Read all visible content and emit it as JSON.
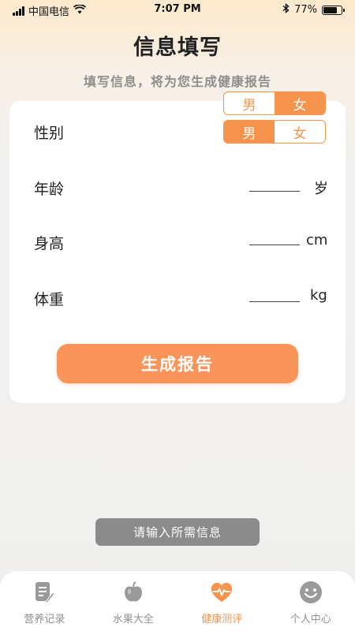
{
  "status_bar": {
    "carrier": "中国电信",
    "time": "7:07 PM",
    "battery": "77%",
    "battery_level": 0.77,
    "icons": [
      "signal-icon",
      "wifi-icon",
      "bluetooth-icon",
      "battery-icon"
    ]
  },
  "header": {
    "title": "信息填写",
    "subtitle": "填写信息，将为您生成健康报告"
  },
  "gender_toggle_top": {
    "options": [
      "男",
      "女"
    ],
    "selected": "女"
  },
  "form": {
    "gender": {
      "label": "性别",
      "options": [
        "男",
        "女"
      ],
      "selected": "男"
    },
    "age": {
      "label": "年龄",
      "value": "",
      "unit": "岁"
    },
    "height": {
      "label": "身高",
      "value": "",
      "unit": "cm"
    },
    "weight": {
      "label": "体重",
      "value": "",
      "unit": "kg"
    },
    "submit_label": "生成报告"
  },
  "toast": {
    "message": "请输入所需信息"
  },
  "tab_bar": {
    "active": "health",
    "tabs": [
      {
        "key": "nutrition",
        "label": "营养记录",
        "icon": "notes-icon"
      },
      {
        "key": "fruits",
        "label": "水果大全",
        "icon": "fruit-icon"
      },
      {
        "key": "health",
        "label": "健康测评",
        "icon": "heart-pulse-icon"
      },
      {
        "key": "profile",
        "label": "个人中心",
        "icon": "smiley-icon"
      }
    ]
  },
  "colors": {
    "accent": "#f6934c",
    "button": "#f9955a",
    "toast_bg": "#8b8b8b",
    "tab_inactive": "#8f8f8f"
  }
}
